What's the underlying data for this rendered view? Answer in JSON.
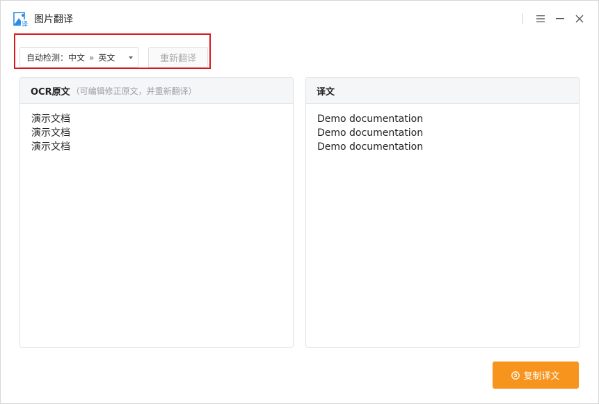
{
  "window": {
    "title": "图片翻译"
  },
  "toolbar": {
    "source_lang": "自动检测：中文",
    "separator": "»",
    "target_lang": "英文",
    "retranslate_label": "重新翻译"
  },
  "source_panel": {
    "title": "OCR原文",
    "hint": "（可编辑修正原文，并重新翻译）",
    "lines": [
      "演示文档",
      "演示文档",
      "演示文档"
    ]
  },
  "target_panel": {
    "title": "译文",
    "lines": [
      "Demo documentation",
      "Demo documentation",
      "Demo documentation"
    ]
  },
  "actions": {
    "copy_label": "复制译文"
  },
  "icons": {
    "app": "image-translate-icon",
    "menu": "menu-icon",
    "minimize": "minimize-icon",
    "close": "close-icon",
    "copy": "copy-icon",
    "dropdown": "caret-down-icon"
  },
  "colors": {
    "accent": "#f7941d",
    "highlight": "#d9161c",
    "brand_blue": "#2b8ce6"
  }
}
